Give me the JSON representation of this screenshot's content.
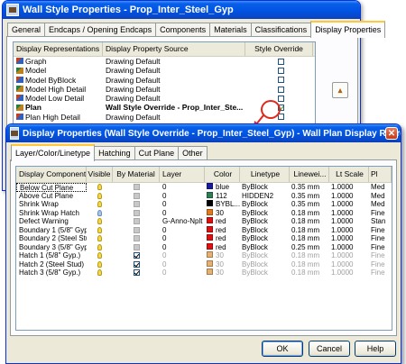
{
  "wall_style_window": {
    "title": "Wall Style Properties - Prop_Inter_Steel_Gyp",
    "tabs": [
      {
        "label": "General",
        "active": false
      },
      {
        "label": "Endcaps / Opening Endcaps",
        "active": false
      },
      {
        "label": "Components",
        "active": false
      },
      {
        "label": "Materials",
        "active": false
      },
      {
        "label": "Classifications",
        "active": false
      },
      {
        "label": "Display Properties",
        "active": true
      }
    ],
    "columns": [
      "Display Representations",
      "Display Property Source",
      "Style Override"
    ],
    "rows": [
      {
        "name": "Graph",
        "source": "Drawing Default",
        "override": false,
        "bold": false
      },
      {
        "name": "Model",
        "source": "Drawing Default",
        "override": false,
        "bold": false
      },
      {
        "name": "Model ByBlock",
        "source": "Drawing Default",
        "override": false,
        "bold": false
      },
      {
        "name": "Model High Detail",
        "source": "Drawing Default",
        "override": false,
        "bold": false
      },
      {
        "name": "Model Low Detail",
        "source": "Drawing Default",
        "override": false,
        "bold": false
      },
      {
        "name": "Plan",
        "source": "Wall Style Override - Prop_Inter_Ste...",
        "override": true,
        "bold": true
      },
      {
        "name": "Plan High Detail",
        "source": "Drawing Default",
        "override": false,
        "bold": false
      }
    ]
  },
  "display_properties_window": {
    "title": "Display Properties (Wall Style Override - Prop_Inter_Steel_Gyp) - Wall Plan Display Represent...",
    "tabs": [
      {
        "label": "Layer/Color/Linetype",
        "active": true
      },
      {
        "label": "Hatching",
        "active": false
      },
      {
        "label": "Cut Plane",
        "active": false
      },
      {
        "label": "Other",
        "active": false
      }
    ],
    "columns": [
      "Display Component",
      "Visible",
      "By Material",
      "Layer",
      "Color",
      "Linetype",
      "Linewei...",
      "Lt Scale",
      "Pl"
    ],
    "rows": [
      {
        "component": "Below Cut Plane",
        "visible": true,
        "by_material": false,
        "layer": "0",
        "color_name": "blue",
        "color_hex": "#1a1aa0",
        "linetype": "ByBlock",
        "lineweight": "0.35 mm",
        "lt_scale": "1.0000",
        "plot": "Med",
        "dim": false
      },
      {
        "component": "Above Cut Plane",
        "visible": true,
        "by_material": false,
        "layer": "0",
        "color_name": "112",
        "color_hex": "#2e7d55",
        "linetype": "HIDDEN2",
        "lineweight": "0.35 mm",
        "lt_scale": "1.0000",
        "plot": "Med",
        "dim": false
      },
      {
        "component": "Shrink Wrap",
        "visible": true,
        "by_material": false,
        "layer": "0",
        "color_name": "BYBL...",
        "color_hex": "#000000",
        "linetype": "ByBlock",
        "lineweight": "0.35 mm",
        "lt_scale": "1.0000",
        "plot": "Med",
        "dim": false
      },
      {
        "component": "Shrink Wrap Hatch",
        "visible": false,
        "by_material": false,
        "layer": "0",
        "color_name": "30",
        "color_hex": "#e07a1a",
        "linetype": "ByBlock",
        "lineweight": "0.18 mm",
        "lt_scale": "1.0000",
        "plot": "Fine",
        "dim": false
      },
      {
        "component": "Defect Warning",
        "visible": true,
        "by_material": false,
        "layer": "G-Anno-Nplt",
        "color_name": "red",
        "color_hex": "#e01010",
        "linetype": "ByBlock",
        "lineweight": "0.18 mm",
        "lt_scale": "1.0000",
        "plot": "Stan",
        "dim": false
      },
      {
        "component": "Boundary 1 (5/8\" Gyp.)",
        "visible": true,
        "by_material": false,
        "layer": "0",
        "color_name": "red",
        "color_hex": "#e01010",
        "linetype": "ByBlock",
        "lineweight": "0.18 mm",
        "lt_scale": "1.0000",
        "plot": "Fine",
        "dim": false
      },
      {
        "component": "Boundary 2 (Steel Stud)",
        "visible": true,
        "by_material": false,
        "layer": "0",
        "color_name": "red",
        "color_hex": "#e01010",
        "linetype": "ByBlock",
        "lineweight": "0.18 mm",
        "lt_scale": "1.0000",
        "plot": "Fine",
        "dim": false
      },
      {
        "component": "Boundary 3 (5/8\" Gyp.)",
        "visible": true,
        "by_material": false,
        "layer": "0",
        "color_name": "red",
        "color_hex": "#e01010",
        "linetype": "ByBlock",
        "lineweight": "0.25 mm",
        "lt_scale": "1.0000",
        "plot": "Fine",
        "dim": false
      },
      {
        "component": "Hatch 1 (5/8\" Gyp.)",
        "visible": true,
        "by_material": true,
        "layer": "0",
        "color_name": "30",
        "color_hex": "#e8b070",
        "linetype": "ByBlock",
        "lineweight": "0.18 mm",
        "lt_scale": "1.0000",
        "plot": "Fine",
        "dim": true
      },
      {
        "component": "Hatch 2 (Steel Stud)",
        "visible": true,
        "by_material": true,
        "layer": "0",
        "color_name": "30",
        "color_hex": "#e8b070",
        "linetype": "ByBlock",
        "lineweight": "0.18 mm",
        "lt_scale": "1.0000",
        "plot": "Fine",
        "dim": true
      },
      {
        "component": "Hatch 3 (5/8\" Gyp.)",
        "visible": true,
        "by_material": true,
        "layer": "0",
        "color_name": "30",
        "color_hex": "#e8b070",
        "linetype": "ByBlock",
        "lineweight": "0.18 mm",
        "lt_scale": "1.0000",
        "plot": "Fine",
        "dim": true
      }
    ],
    "buttons": {
      "ok": "OK",
      "cancel": "Cancel",
      "help": "Help"
    }
  },
  "colors": {
    "titlebar": "#0055e5",
    "highlight_circle": "#e0281c",
    "dialog_bg": "#ece9d8"
  }
}
